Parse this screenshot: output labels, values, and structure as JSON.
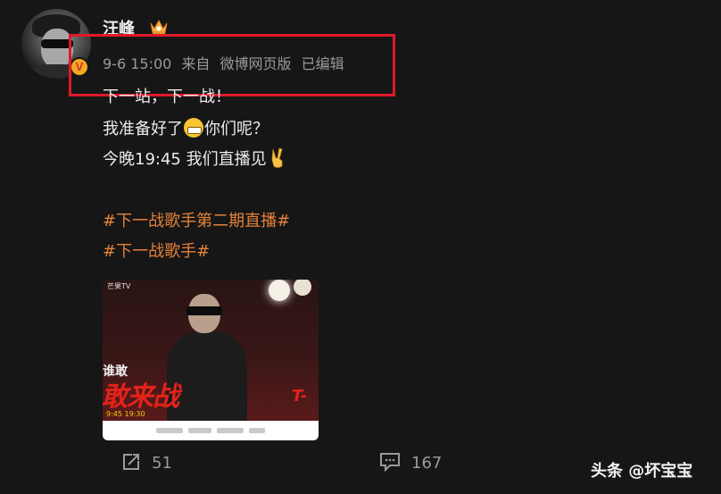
{
  "post": {
    "author": "汪峰",
    "meta": {
      "date": "9-6 15:00",
      "source_prefix": "来自",
      "source": "微博网页版",
      "edited": "已编辑"
    },
    "lines": [
      "下一站，下一战！",
      "我准备好了",
      "你们呢？",
      "今晚19:45 我们直播见"
    ],
    "hashtags": [
      "#下一战歌手第二期直播#",
      "#下一战歌手#"
    ],
    "image": {
      "brand": "芒果TV",
      "sign_small": "谁敢",
      "sign": "敢来战",
      "tower_text": "T-",
      "time": "9:45 19:30"
    },
    "actions": {
      "repost_count": "51",
      "comment_count": "167"
    }
  },
  "watermark": "头条 @坏宝宝",
  "colors": {
    "background": "#161616",
    "hashtag": "#e5823a",
    "highlight_box": "#e0192a",
    "verified_badge": "#f5a623"
  },
  "icons": [
    "crown-icon",
    "verified-icon",
    "grin-emoji-icon",
    "victory-emoji-icon",
    "repost-icon",
    "comment-icon"
  ]
}
